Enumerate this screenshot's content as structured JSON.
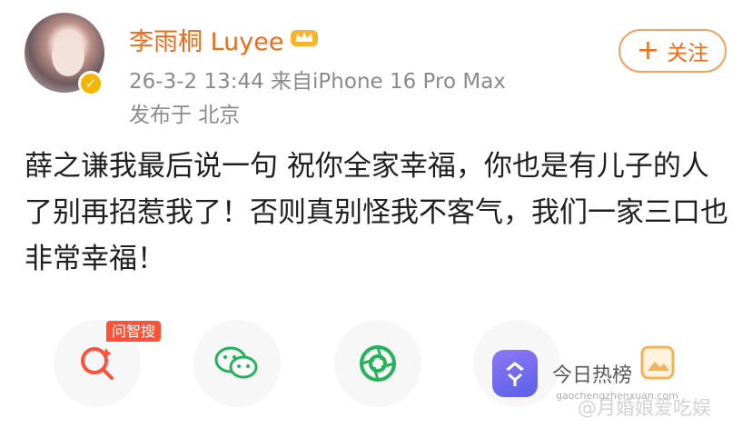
{
  "header": {
    "username": "李雨桐 Luyee",
    "meta": "26-3-2 13:44  来自iPhone 16 Pro Max",
    "location": "发布于 北京",
    "follow_label": "关注"
  },
  "post": {
    "text": "薛之谦我最后说一句 祝你全家幸福，你也是有儿子的人了别再招惹我了！否则真别怪我不客气，我们一家三口也非常幸福！"
  },
  "share": {
    "badge": "问智搜",
    "hot_label": "今日热榜"
  },
  "watermark": {
    "url": "gaochengzhenxuan.com",
    "name": "@月婚娘爱吃娱"
  },
  "icons": [
    "crown-icon",
    "verified-icon",
    "plus-icon",
    "search-ai-icon",
    "wechat-icon",
    "moments-icon",
    "hot-list-icon",
    "photo-icon"
  ],
  "colors": {
    "accent": "#f06a18",
    "meta_gray": "#8b8b8b",
    "badge_red": "#ff5038"
  }
}
